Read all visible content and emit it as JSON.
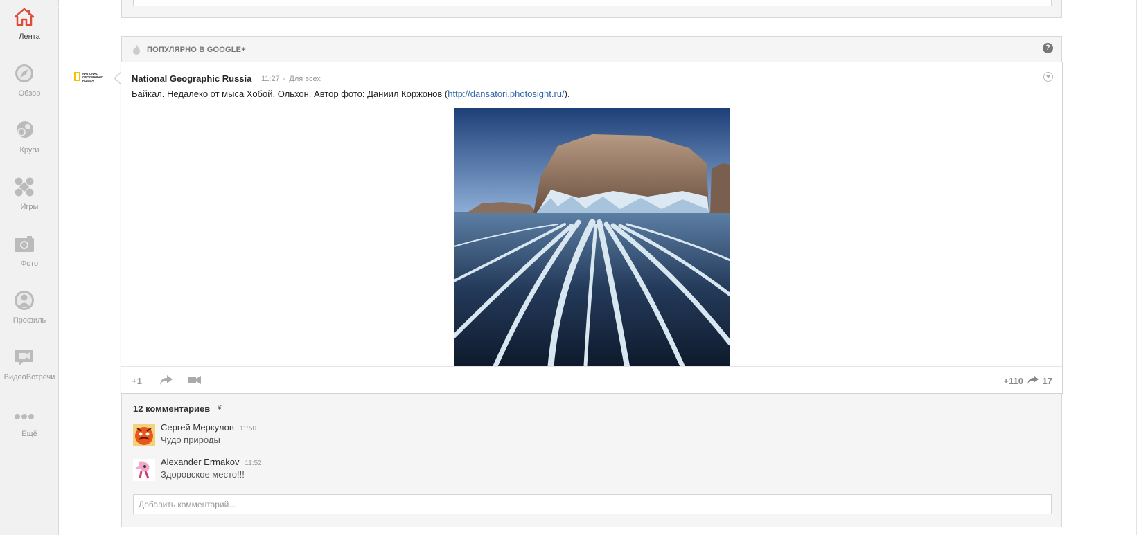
{
  "nav": {
    "items": [
      {
        "label": "Лента",
        "icon": "home-icon",
        "active": true
      },
      {
        "label": "Обзор",
        "icon": "compass-icon",
        "active": false
      },
      {
        "label": "Круги",
        "icon": "circles-icon",
        "active": false
      },
      {
        "label": "Игры",
        "icon": "games-icon",
        "active": false
      },
      {
        "label": "Фото",
        "icon": "camera-icon",
        "active": false
      },
      {
        "label": "Профиль",
        "icon": "profile-icon",
        "active": false
      },
      {
        "label": "ВидеоВстречи",
        "icon": "hangout-icon",
        "active": false
      },
      {
        "label": "Ещё",
        "icon": "more-icon",
        "active": false
      }
    ]
  },
  "popular": {
    "title": "ПОПУЛЯРНО В GOOGLE+",
    "help_icon": "help-icon",
    "help_label": "?"
  },
  "post": {
    "logo_text": "NATIONAL\nGEOGRAPHIC\nRUSSIA",
    "author": "National Geographic Russia",
    "time": "11:27",
    "separator": "-",
    "visibility": "Для всех",
    "text_before": "Байкал. Недалеко от мыса Хобой, Ольхон. Автор фото: Даниил Коржонов (",
    "link": "http://dansatori.photosight.ru/",
    "text_after": ").",
    "photo_icon": "baikal-ice-photo",
    "actions": {
      "plus_one": "+1",
      "plus_count": "+110",
      "share_count": "17"
    }
  },
  "comments": {
    "count_label": "12 комментариев",
    "expand_glyph": "¥",
    "items": [
      {
        "author": "Сергей Меркулов",
        "time": "11:50",
        "text": "Чудо природы"
      },
      {
        "author": "Alexander Ermakov",
        "time": "11:52",
        "text": "Здоровское место!!!"
      }
    ],
    "add_placeholder": "Добавить комментарий..."
  },
  "colors": {
    "link": "#3366aa",
    "rail_bg": "#f1f1f1",
    "card_bg": "#f5f5f5",
    "active_icon": "#dd4b39"
  }
}
